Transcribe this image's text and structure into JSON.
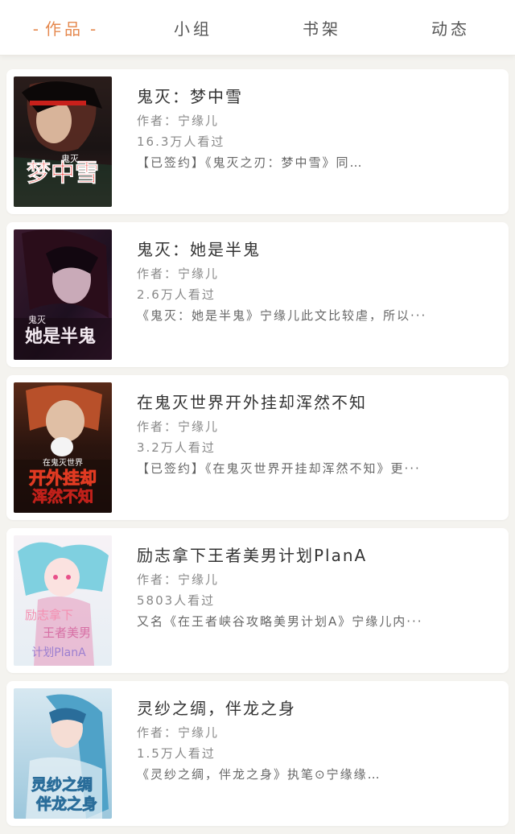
{
  "tabs": [
    {
      "label": "作品",
      "active": true
    },
    {
      "label": "小组",
      "active": false
    },
    {
      "label": "书架",
      "active": false
    },
    {
      "label": "动态",
      "active": false
    }
  ],
  "tab_active_decoration": "-",
  "colors": {
    "accent": "#e5894f",
    "background": "#f4f3ef",
    "card": "#ffffff"
  },
  "books": [
    {
      "title": "鬼灭：梦中雪",
      "author": "作者：宁缘儿",
      "readers": "16.3万人看过",
      "desc": "【已签约】《鬼灭之刃：梦中雪》同…",
      "cover_text": [
        "鬼灭",
        "梦中雪"
      ],
      "cover_colors": [
        "#1a1414",
        "#5a2b22",
        "#c8201b"
      ]
    },
    {
      "title": "鬼灭：她是半鬼",
      "author": "作者：宁缘儿",
      "readers": "2.6万人看过",
      "desc": "《鬼灭：她是半鬼》宁缘儿此文比较虐，所以···",
      "cover_text": [
        "鬼灭",
        "她是半鬼"
      ],
      "cover_colors": [
        "#2a1424",
        "#6a2a4a",
        "#e6d7e8"
      ]
    },
    {
      "title": "在鬼灭世界开外挂却浑然不知",
      "author": "作者：宁缘儿",
      "readers": "3.2万人看过",
      "desc": "【已签约】《在鬼灭世界开挂却浑然不知》更···",
      "cover_text": [
        "在鬼灭世界",
        "开外挂却",
        "浑然不知"
      ],
      "cover_colors": [
        "#3a1a12",
        "#b8502a",
        "#e03a22"
      ]
    },
    {
      "title": "励志拿下王者美男计划PlanA",
      "author": "作者：宁缘儿",
      "readers": "5803人看过",
      "desc": "又名《在王者峡谷攻略美男计划A》宁缘儿内···",
      "cover_text": [
        "励志拿下",
        "王者美男",
        "计划PlanA"
      ],
      "cover_colors": [
        "#f4eef5",
        "#7fd0e0",
        "#e8a9c7"
      ]
    },
    {
      "title": "灵纱之绸，伴龙之身",
      "author": "作者：宁缘儿",
      "readers": "1.5万人看过",
      "desc": "《灵纱之绸，伴龙之身》执笔⊙宁缘缘…",
      "cover_text": [
        "灵纱之绸",
        "伴龙之身"
      ],
      "cover_colors": [
        "#cfe3ee",
        "#5fa8c8",
        "#2a6d9a"
      ]
    }
  ]
}
